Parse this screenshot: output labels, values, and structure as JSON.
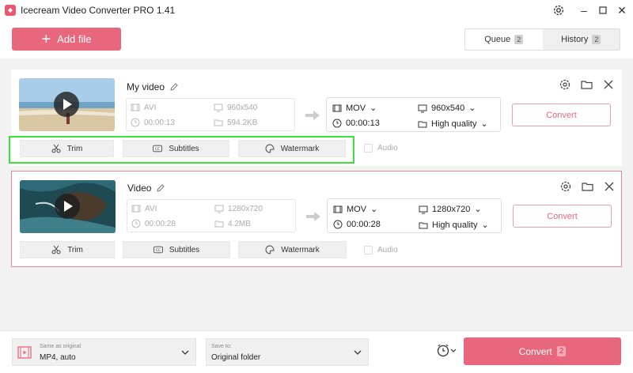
{
  "window": {
    "title": "Icecream Video Converter PRO 1.41"
  },
  "toolbar": {
    "add_file_label": "Add file"
  },
  "tabs": [
    {
      "label": "Queue",
      "count": "2",
      "active": true
    },
    {
      "label": "History",
      "count": "2",
      "active": false
    }
  ],
  "videos": [
    {
      "name": "My video",
      "source": {
        "format": "AVI",
        "resolution": "960x540",
        "duration": "00:00:13",
        "size": "594.2KB"
      },
      "output": {
        "format": "MOV",
        "resolution": "960x540",
        "duration": "00:00:13",
        "quality": "High quality"
      },
      "convert_label": "Convert",
      "tools": {
        "trim": "Trim",
        "subtitles": "Subtitles",
        "watermark": "Watermark",
        "audio": "Audio"
      }
    },
    {
      "name": "Video",
      "source": {
        "format": "AVI",
        "resolution": "1280x720",
        "duration": "00:00:28",
        "size": "4.2MB"
      },
      "output": {
        "format": "MOV",
        "resolution": "1280x720",
        "duration": "00:00:28",
        "quality": "High quality"
      },
      "convert_label": "Convert",
      "tools": {
        "trim": "Trim",
        "subtitles": "Subtitles",
        "watermark": "Watermark",
        "audio": "Audio"
      }
    }
  ],
  "bottom": {
    "format_caption": "Same as original",
    "format_value": "MP4, auto",
    "save_caption": "Save to:",
    "save_value": "Original folder",
    "convert_all_label": "Convert",
    "convert_all_count": "2"
  },
  "colors": {
    "accent": "#e8677c",
    "highlight": "#3ee03e"
  }
}
